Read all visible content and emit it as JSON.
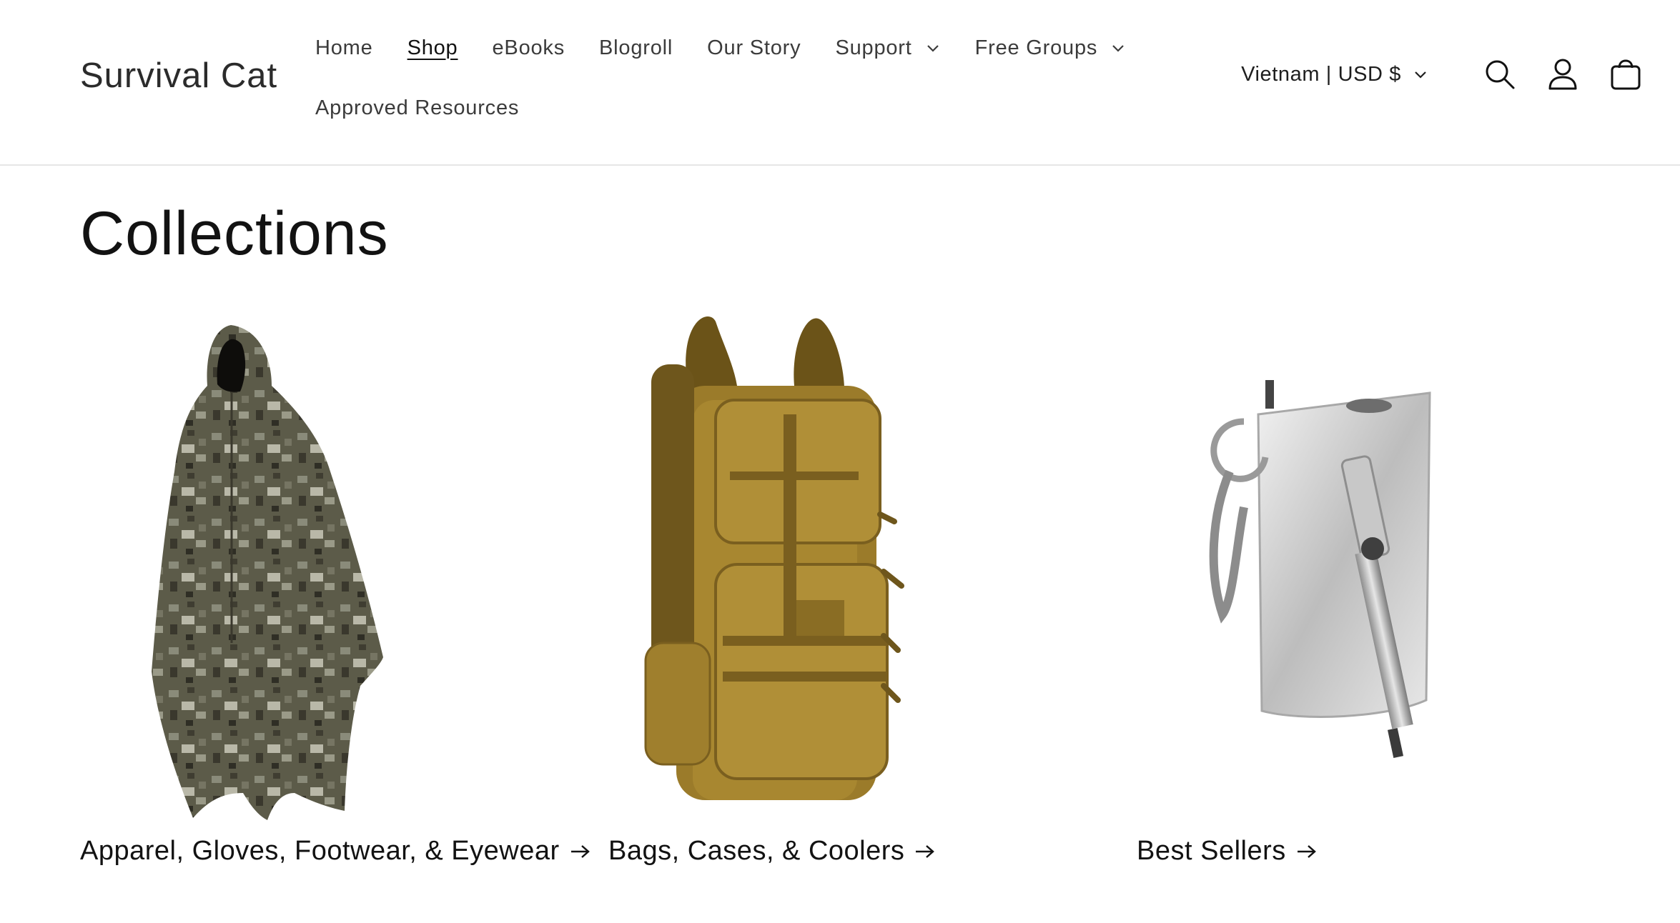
{
  "header": {
    "logo": "Survival Cat",
    "nav": [
      {
        "label": "Home"
      },
      {
        "label": "Shop"
      },
      {
        "label": "eBooks"
      },
      {
        "label": "Blogroll"
      },
      {
        "label": "Our Story"
      },
      {
        "label": "Support"
      },
      {
        "label": "Free Groups"
      },
      {
        "label": "Approved Resources"
      }
    ],
    "country_selector": "Vietnam | USD $",
    "icons": [
      "search-icon",
      "account-icon",
      "cart-icon"
    ]
  },
  "main": {
    "title": "Collections",
    "collections": [
      {
        "label": "Apparel, Gloves, Footwear, & Eyewear",
        "image": "camo-poncho-image"
      },
      {
        "label": "Bags, Cases, & Coolers",
        "image": "tactical-backpack-image"
      },
      {
        "label": "Best Sellers",
        "image": "fire-starter-image"
      }
    ]
  },
  "colors": {
    "text": "#121212",
    "nav_text": "#3b3b3b",
    "divider": "#e6e6e6",
    "background": "#ffffff"
  }
}
